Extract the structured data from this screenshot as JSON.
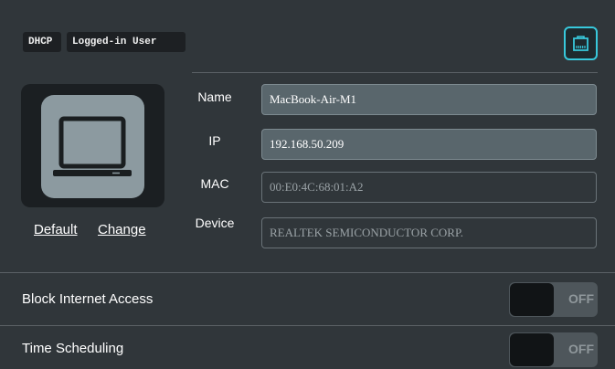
{
  "header": {
    "dhcp_badge": "DHCP",
    "user_badge": "Logged-in User",
    "ethernet_icon": "ethernet-port-icon"
  },
  "device": {
    "icon": "laptop-icon",
    "default_link": "Default",
    "change_link": "Change"
  },
  "fields": {
    "name_label": "Name",
    "name_value": "MacBook-Air-M1",
    "ip_label": "IP",
    "ip_value": "192.168.50.209",
    "mac_label": "MAC",
    "mac_value": "00:E0:4C:68:01:A2",
    "device_label": "Device",
    "device_value": "REALTEK SEMICONDUCTOR CORP."
  },
  "settings": {
    "block_internet_label": "Block Internet Access",
    "block_internet_state": "OFF",
    "time_scheduling_label": "Time Scheduling",
    "time_scheduling_state": "OFF"
  },
  "colors": {
    "accent": "#38c9dc",
    "background": "#30363a"
  }
}
